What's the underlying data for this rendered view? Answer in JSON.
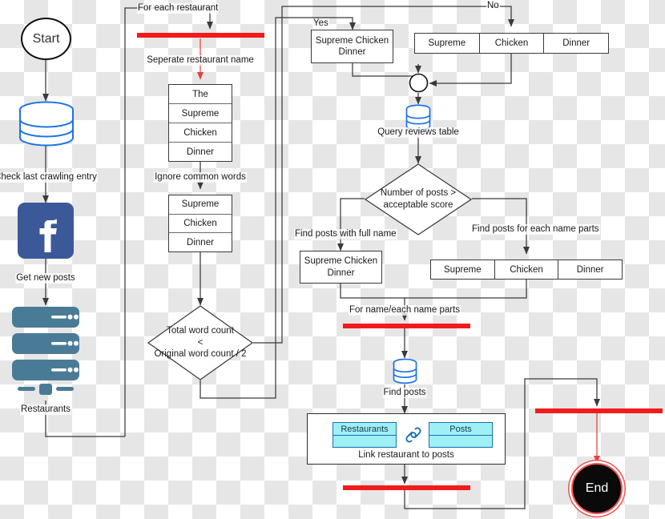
{
  "diagram": {
    "title": "Restaurant review crawling and post-linking flowchart",
    "colors": {
      "red": "#f21b1b",
      "blue": "#1a73e8",
      "facebook_blue": "#3b5998",
      "server_blue": "#4a7b96",
      "table_cyan": "#9ff0f5",
      "line_gray": "#4a4a4a"
    }
  },
  "start": {
    "label": "Start"
  },
  "end": {
    "label": "End"
  },
  "left_column": {
    "check_db_label": "Check last crawling entry",
    "facebook_label": "Get new posts",
    "facebook_icon": "facebook-icon",
    "restaurants_label": "Restaurants",
    "restaurants_icon": "server-rack-icon",
    "db_icon": "database-icon"
  },
  "loop": {
    "for_each_restaurant": "For each restaurant",
    "separate_name": "Seperate restaurant name",
    "ignore_common_words": "Ignore common words"
  },
  "name_table_full": {
    "cells": [
      "The",
      "Supreme",
      "Chicken",
      "Dinner"
    ]
  },
  "name_table_trimmed": {
    "cells": [
      "Supreme",
      "Chicken",
      "Dinner"
    ]
  },
  "word_count_decision": {
    "line1": "Total word count",
    "line2": "<",
    "line3": "Original word count / 2"
  },
  "branches": {
    "yes": "Yes",
    "no": "No"
  },
  "full_name_box_top": {
    "line1": "Supreme Chicken",
    "line2": "Dinner"
  },
  "parts_table_top": {
    "cells": [
      "Supreme",
      "Chicken",
      "Dinner"
    ]
  },
  "merge": {
    "icon": "merge-circle-icon"
  },
  "query_reviews": {
    "label": "Query reviews table",
    "icon": "database-icon"
  },
  "posts_decision": {
    "line1": "Number of posts >",
    "line2": "acceptable score"
  },
  "posts_branches": {
    "full_name": "Find posts with full name",
    "name_parts": "Find posts for each name parts"
  },
  "full_name_box_bottom": {
    "line1": "Supreme Chicken",
    "line2": "Dinner"
  },
  "parts_table_bottom": {
    "cells": [
      "Supreme",
      "Chicken",
      "Dinner"
    ]
  },
  "fork_label": {
    "for_name_parts": "For name/each name parts"
  },
  "find_posts": {
    "label": "Find posts",
    "icon": "database-icon"
  },
  "link_box": {
    "left_table": "Restaurants",
    "right_table": "Posts",
    "link_icon": "chain-link-icon",
    "caption": "Link restaurant to posts"
  }
}
